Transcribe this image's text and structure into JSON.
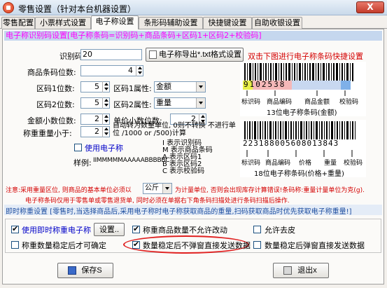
{
  "window": {
    "title": "零售设置（针对本台机器设置）",
    "close_label": "X"
  },
  "tabs": [
    {
      "label": "零售配置"
    },
    {
      "label": "小票样式设置"
    },
    {
      "label": "电子称设置"
    },
    {
      "label": "条形码辅助设置"
    },
    {
      "label": "快捷键设置"
    },
    {
      "label": "自助收银设置"
    }
  ],
  "header": {
    "text": "电子称识别码设置[电子称条码=识别码+商品条码+区码1+区码2+校验码]"
  },
  "fields": {
    "id_code": {
      "label": "识别码:",
      "value": "20"
    },
    "barcode_digits": {
      "label": "商品条码位数:",
      "value": "4"
    },
    "zone1_digits": {
      "label": "区码1位数:",
      "value": "5"
    },
    "zone2_digits": {
      "label": "区码2位数:",
      "value": "5"
    },
    "amount_decimals": {
      "label": "金额小数位数:",
      "value": "2"
    },
    "weight_less_than": {
      "label": "称重重量小于:",
      "value": "2"
    },
    "zone1_attr": {
      "label": "区码1属性:",
      "value": "金额"
    },
    "zone2_attr": {
      "label": "区码2属性:",
      "value": "重量"
    },
    "unit_price_decimals": {
      "label": "单价小数位数:",
      "value": "2"
    }
  },
  "export_button": {
    "label": "电子称导出*.txt格式设置"
  },
  "convert_note": "自动转为数量单位, 0则不转换 不进行单位 /1000 or /500)计算",
  "use_scale": {
    "label": "使用电子称",
    "checked": false
  },
  "sample": {
    "label": "样例:",
    "value": "IIMMMMMAAAAABBBBBC"
  },
  "legend_items": [
    "I 表示识别码",
    "M 表示商品条码",
    "A 表示区码1",
    "B 表示区码2",
    "C 表示校验码"
  ],
  "barcode_hint": "双击下图进行电子称条码快捷设置",
  "barcode13": {
    "digits": "9102538",
    "sub_labels": [
      "标识码",
      "商品编码",
      "商品金额",
      "校验码"
    ],
    "caption": "13位电子称条码(金额)"
  },
  "barcode18": {
    "digits": "223188005608013843",
    "sub_labels": [
      "标识码",
      "商品编码",
      "价格",
      "重量",
      "校验码"
    ],
    "caption": "18位电子称条码(价格+重量)"
  },
  "notice": {
    "part1": "注意:采用重量区位, 则商品的基本单位必须以",
    "unit": "公斤",
    "part2": "为计量单位, 否则会出现库存计算错误!条码称:重量计量单位为克(g).",
    "line2": "电子称条码仅用于零售单或零售退货单, 同时必须在单据右下角条码扫描处进行条码扫描后操作."
  },
  "instant": {
    "header": "即时称重设置 [零售时,当选择商品后,采用电子称时电子称获取商品的重量,扫码获取商品时优先获取电子称重量!]",
    "use_instant": {
      "label": "使用即时称重电子称",
      "checked": true
    },
    "settings_button": "设置..",
    "no_change_qty": {
      "label": "称重商品数量不允许改动",
      "checked": true
    },
    "allow_tare": {
      "label": "允许去皮",
      "checked": false
    },
    "stable_confirm": {
      "label": "称重数量稳定后才可确定",
      "checked": false
    },
    "stable_send_no_popup": {
      "label": "数量稳定后不弹窗直接发送数据",
      "checked": true
    },
    "stable_popup_send": {
      "label": "数量稳定后弹窗直接发送数据",
      "checked": false
    }
  },
  "footer": {
    "save_label": "保存S",
    "exit_label": "退出x"
  },
  "colors": {
    "accent_red": "#d40000",
    "link_blue": "#0000c8",
    "header_magenta": "#ff00ff"
  }
}
